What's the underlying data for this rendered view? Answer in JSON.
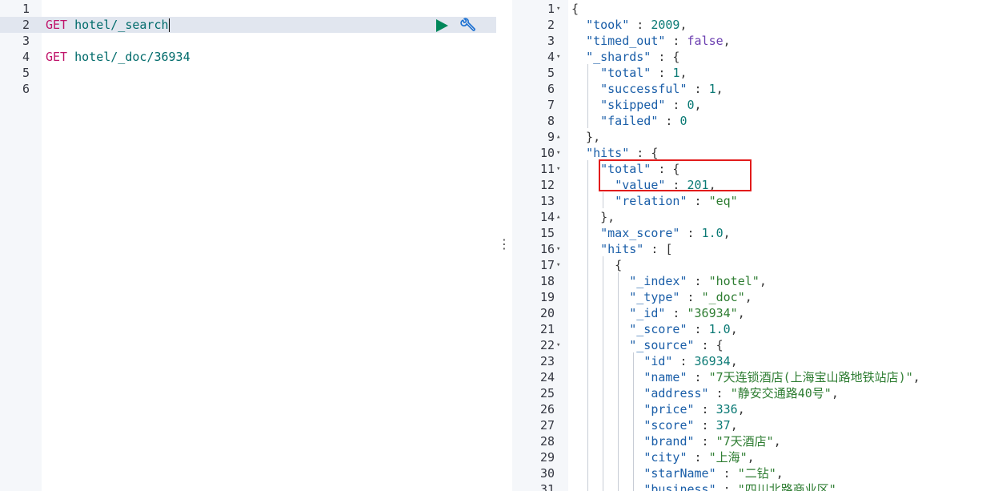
{
  "request_editor": {
    "lines": [
      {
        "n": "1",
        "method": "",
        "path": ""
      },
      {
        "n": "2",
        "method": "GET",
        "path": " hotel/_search",
        "active": true
      },
      {
        "n": "3",
        "method": "",
        "path": ""
      },
      {
        "n": "4",
        "method": "GET",
        "path": " hotel/_doc/36934"
      },
      {
        "n": "5",
        "method": "",
        "path": ""
      },
      {
        "n": "6",
        "method": "",
        "path": ""
      }
    ],
    "run_icon": "play-icon",
    "settings_icon": "wrench-icon"
  },
  "splitter_icon": "vertical-dots-icon",
  "response_viewer": {
    "lines": [
      {
        "n": "1",
        "fold": "▾",
        "t": [
          [
            "{",
            "p"
          ]
        ]
      },
      {
        "n": "2",
        "t": [
          [
            "  ",
            ""
          ],
          [
            "\"took\"",
            "k"
          ],
          [
            " : ",
            "p"
          ],
          [
            "2009",
            "n"
          ],
          [
            ",",
            "p"
          ]
        ]
      },
      {
        "n": "3",
        "t": [
          [
            "  ",
            ""
          ],
          [
            "\"timed_out\"",
            "k"
          ],
          [
            " : ",
            "p"
          ],
          [
            "false",
            "b"
          ],
          [
            ",",
            "p"
          ]
        ]
      },
      {
        "n": "4",
        "fold": "▾",
        "t": [
          [
            "  ",
            ""
          ],
          [
            "\"_shards\"",
            "k"
          ],
          [
            " : {",
            "p"
          ]
        ]
      },
      {
        "n": "5",
        "t": [
          [
            "    ",
            ""
          ],
          [
            "\"total\"",
            "k"
          ],
          [
            " : ",
            "p"
          ],
          [
            "1",
            "n"
          ],
          [
            ",",
            "p"
          ]
        ]
      },
      {
        "n": "6",
        "t": [
          [
            "    ",
            ""
          ],
          [
            "\"successful\"",
            "k"
          ],
          [
            " : ",
            "p"
          ],
          [
            "1",
            "n"
          ],
          [
            ",",
            "p"
          ]
        ]
      },
      {
        "n": "7",
        "t": [
          [
            "    ",
            ""
          ],
          [
            "\"skipped\"",
            "k"
          ],
          [
            " : ",
            "p"
          ],
          [
            "0",
            "n"
          ],
          [
            ",",
            "p"
          ]
        ]
      },
      {
        "n": "8",
        "t": [
          [
            "    ",
            ""
          ],
          [
            "\"failed\"",
            "k"
          ],
          [
            " : ",
            "p"
          ],
          [
            "0",
            "n"
          ]
        ]
      },
      {
        "n": "9",
        "fold": "▴",
        "t": [
          [
            "  },",
            "p"
          ]
        ]
      },
      {
        "n": "10",
        "fold": "▾",
        "t": [
          [
            "  ",
            ""
          ],
          [
            "\"hits\"",
            "k"
          ],
          [
            " : {",
            "p"
          ]
        ]
      },
      {
        "n": "11",
        "fold": "▾",
        "t": [
          [
            "    ",
            ""
          ],
          [
            "\"total\"",
            "k"
          ],
          [
            " : {",
            "p"
          ]
        ]
      },
      {
        "n": "12",
        "t": [
          [
            "      ",
            ""
          ],
          [
            "\"value\"",
            "k"
          ],
          [
            " : ",
            "p"
          ],
          [
            "201",
            "n"
          ],
          [
            ",",
            "p"
          ]
        ]
      },
      {
        "n": "13",
        "t": [
          [
            "      ",
            ""
          ],
          [
            "\"relation\"",
            "k"
          ],
          [
            " : ",
            "p"
          ],
          [
            "\"eq\"",
            "s"
          ]
        ]
      },
      {
        "n": "14",
        "fold": "▴",
        "t": [
          [
            "    },",
            "p"
          ]
        ]
      },
      {
        "n": "15",
        "t": [
          [
            "    ",
            ""
          ],
          [
            "\"max_score\"",
            "k"
          ],
          [
            " : ",
            "p"
          ],
          [
            "1.0",
            "n"
          ],
          [
            ",",
            "p"
          ]
        ]
      },
      {
        "n": "16",
        "fold": "▾",
        "t": [
          [
            "    ",
            ""
          ],
          [
            "\"hits\"",
            "k"
          ],
          [
            " : [",
            "p"
          ]
        ]
      },
      {
        "n": "17",
        "fold": "▾",
        "t": [
          [
            "      {",
            "p"
          ]
        ]
      },
      {
        "n": "18",
        "t": [
          [
            "        ",
            ""
          ],
          [
            "\"_index\"",
            "k"
          ],
          [
            " : ",
            "p"
          ],
          [
            "\"hotel\"",
            "s"
          ],
          [
            ",",
            "p"
          ]
        ]
      },
      {
        "n": "19",
        "t": [
          [
            "        ",
            ""
          ],
          [
            "\"_type\"",
            "k"
          ],
          [
            " : ",
            "p"
          ],
          [
            "\"_doc\"",
            "s"
          ],
          [
            ",",
            "p"
          ]
        ]
      },
      {
        "n": "20",
        "t": [
          [
            "        ",
            ""
          ],
          [
            "\"_id\"",
            "k"
          ],
          [
            " : ",
            "p"
          ],
          [
            "\"36934\"",
            "s"
          ],
          [
            ",",
            "p"
          ]
        ]
      },
      {
        "n": "21",
        "t": [
          [
            "        ",
            ""
          ],
          [
            "\"_score\"",
            "k"
          ],
          [
            " : ",
            "p"
          ],
          [
            "1.0",
            "n"
          ],
          [
            ",",
            "p"
          ]
        ]
      },
      {
        "n": "22",
        "fold": "▾",
        "t": [
          [
            "        ",
            ""
          ],
          [
            "\"_source\"",
            "k"
          ],
          [
            " : {",
            "p"
          ]
        ]
      },
      {
        "n": "23",
        "t": [
          [
            "          ",
            ""
          ],
          [
            "\"id\"",
            "k"
          ],
          [
            " : ",
            "p"
          ],
          [
            "36934",
            "n"
          ],
          [
            ",",
            "p"
          ]
        ]
      },
      {
        "n": "24",
        "t": [
          [
            "          ",
            ""
          ],
          [
            "\"name\"",
            "k"
          ],
          [
            " : ",
            "p"
          ],
          [
            "\"7天连锁酒店(上海宝山路地铁站店)\"",
            "s"
          ],
          [
            ",",
            "p"
          ]
        ]
      },
      {
        "n": "25",
        "t": [
          [
            "          ",
            ""
          ],
          [
            "\"address\"",
            "k"
          ],
          [
            " : ",
            "p"
          ],
          [
            "\"静安交通路40号\"",
            "s"
          ],
          [
            ",",
            "p"
          ]
        ]
      },
      {
        "n": "26",
        "t": [
          [
            "          ",
            ""
          ],
          [
            "\"price\"",
            "k"
          ],
          [
            " : ",
            "p"
          ],
          [
            "336",
            "n"
          ],
          [
            ",",
            "p"
          ]
        ]
      },
      {
        "n": "27",
        "t": [
          [
            "          ",
            ""
          ],
          [
            "\"score\"",
            "k"
          ],
          [
            " : ",
            "p"
          ],
          [
            "37",
            "n"
          ],
          [
            ",",
            "p"
          ]
        ]
      },
      {
        "n": "28",
        "t": [
          [
            "          ",
            ""
          ],
          [
            "\"brand\"",
            "k"
          ],
          [
            " : ",
            "p"
          ],
          [
            "\"7天酒店\"",
            "s"
          ],
          [
            ",",
            "p"
          ]
        ]
      },
      {
        "n": "29",
        "t": [
          [
            "          ",
            ""
          ],
          [
            "\"city\"",
            "k"
          ],
          [
            " : ",
            "p"
          ],
          [
            "\"上海\"",
            "s"
          ],
          [
            ",",
            "p"
          ]
        ]
      },
      {
        "n": "30",
        "t": [
          [
            "          ",
            ""
          ],
          [
            "\"starName\"",
            "k"
          ],
          [
            " : ",
            "p"
          ],
          [
            "\"二钻\"",
            "s"
          ],
          [
            ",",
            "p"
          ]
        ]
      },
      {
        "n": "31",
        "t": [
          [
            "          ",
            ""
          ],
          [
            "\"business\"",
            "k"
          ],
          [
            " : ",
            "p"
          ],
          [
            "\"四川北路商业区\"",
            "s"
          ],
          [
            ",",
            "p"
          ]
        ]
      }
    ]
  },
  "colors": {
    "method": "#c0156b",
    "path": "#006b6b",
    "key": "#1a5ea8",
    "number": "#0b7a75",
    "boolean": "#6b3fb0",
    "string": "#2e7d32",
    "highlight_border": "#e21b1b",
    "active_line": "#e1e6ef"
  }
}
